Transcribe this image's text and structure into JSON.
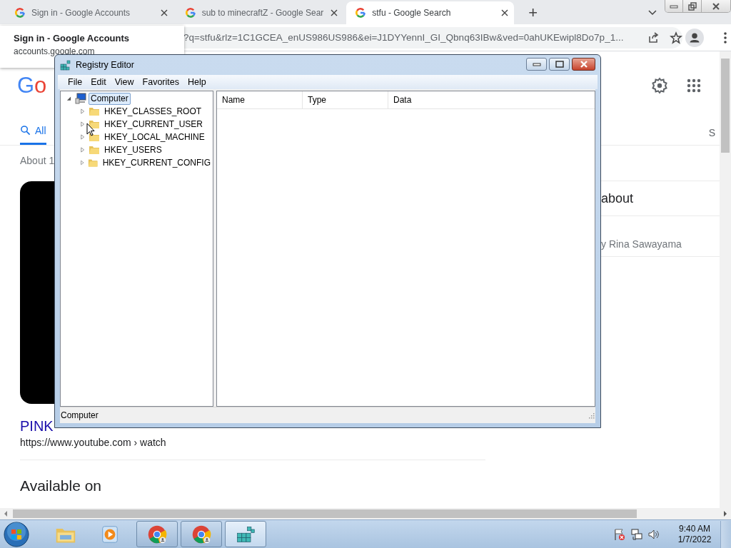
{
  "browser": {
    "tabs": [
      {
        "title": "Sign in - Google Accounts",
        "selected": false
      },
      {
        "title": "sub to minecraftZ - Google Sear",
        "selected": false
      },
      {
        "title": "stfu - Google Search",
        "selected": true
      }
    ],
    "new_tab": "+",
    "tooltip": {
      "title": "Sign in - Google Accounts",
      "url": "accounts.google.com"
    },
    "address": "?q=stfu&rlz=1C1GCEA_enUS986US986&ei=J1DYYennI_GI_Qbnq63IBw&ved=0ahUKEwipl8Do7p_1..."
  },
  "page": {
    "logo": "Go",
    "search_tabs": [
      {
        "label": "All",
        "selected": true
      },
      {
        "label": "S",
        "selected": false
      }
    ],
    "result_stats": "About 1",
    "result": {
      "title": "PINK",
      "url": "https://www.youtube.com › watch"
    },
    "section": "Available on",
    "panel": {
      "heading": "about",
      "subtitle": "y Rina Sawayama"
    }
  },
  "regedit": {
    "title": "Registry Editor",
    "menu": [
      "File",
      "Edit",
      "View",
      "Favorites",
      "Help"
    ],
    "tree": [
      {
        "label": "Computer",
        "kind": "computer",
        "selected": true,
        "expanded": true,
        "children": [
          {
            "label": "HKEY_CLASSES_ROOT",
            "kind": "folder",
            "selected": false,
            "expanded": false
          },
          {
            "label": "HKEY_CURRENT_USER",
            "kind": "folder",
            "selected": false,
            "expanded": false
          },
          {
            "label": "HKEY_LOCAL_MACHINE",
            "kind": "folder",
            "selected": false,
            "expanded": false
          },
          {
            "label": "HKEY_USERS",
            "kind": "folder",
            "selected": false,
            "expanded": false
          },
          {
            "label": "HKEY_CURRENT_CONFIG",
            "kind": "folder",
            "selected": false,
            "expanded": false
          }
        ]
      }
    ],
    "columns": [
      "Name",
      "Type",
      "Data"
    ],
    "status": "Computer"
  },
  "taskbar": {
    "apps": [
      {
        "kind": "explorer",
        "open": false,
        "selected": false
      },
      {
        "kind": "media",
        "open": false,
        "selected": false
      },
      {
        "kind": "chrome",
        "open": true,
        "selected": false
      },
      {
        "kind": "chrome",
        "open": true,
        "selected": false
      },
      {
        "kind": "regedit",
        "open": true,
        "selected": true
      }
    ],
    "time": "9:40 AM",
    "date": "1/7/2022"
  }
}
